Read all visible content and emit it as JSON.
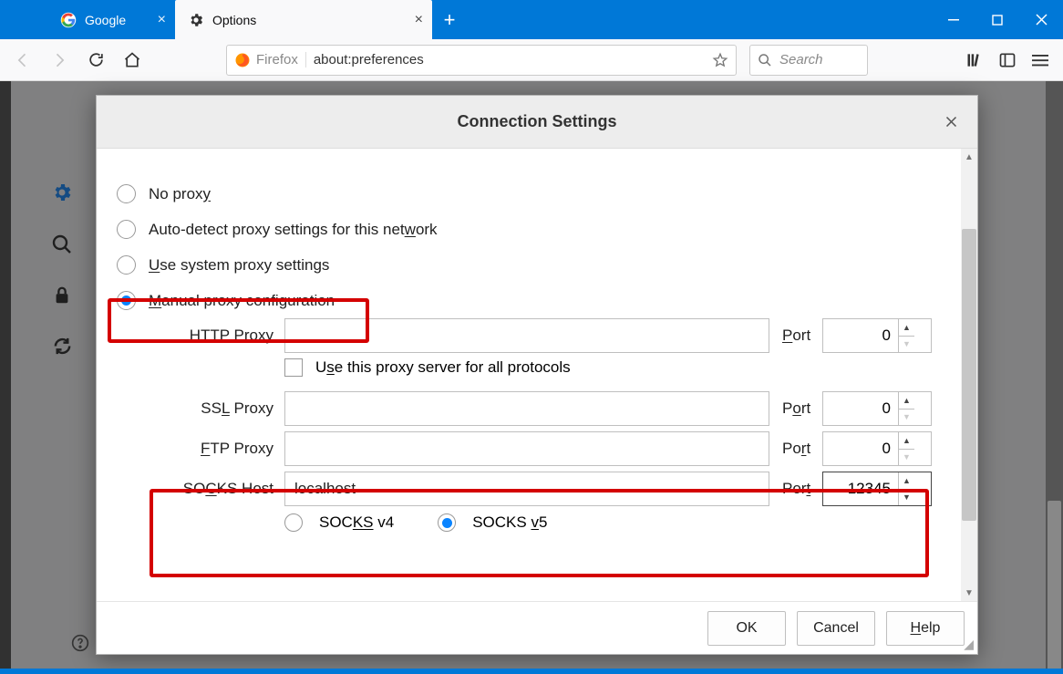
{
  "tabs": {
    "google": {
      "title": "Google"
    },
    "options": {
      "title": "Options"
    }
  },
  "urlbar": {
    "identity": "Firefox",
    "url": "about:preferences"
  },
  "searchbar": {
    "placeholder": "Search"
  },
  "modal": {
    "title": "Connection Settings",
    "radios": {
      "no_proxy": "No proxy",
      "auto_detect": "Auto-detect proxy settings for this network",
      "system": "Use system proxy settings",
      "manual": "Manual proxy configuration"
    },
    "fields": {
      "http_label": "HTTP Proxy",
      "http_value": "",
      "ssl_label": "SSL Proxy",
      "ssl_value": "",
      "ftp_label": "FTP Proxy",
      "ftp_value": "",
      "socks_label": "SOCKS Host",
      "socks_value": "localhost",
      "port_label": "Port",
      "http_port": "0",
      "ssl_port": "0",
      "ftp_port": "0",
      "socks_port": "12345"
    },
    "use_all": "Use this proxy server for all protocols",
    "socks_v4": "SOCKS v4",
    "socks_v5": "SOCKS v5",
    "buttons": {
      "ok": "OK",
      "cancel": "Cancel",
      "help": "Help"
    }
  }
}
